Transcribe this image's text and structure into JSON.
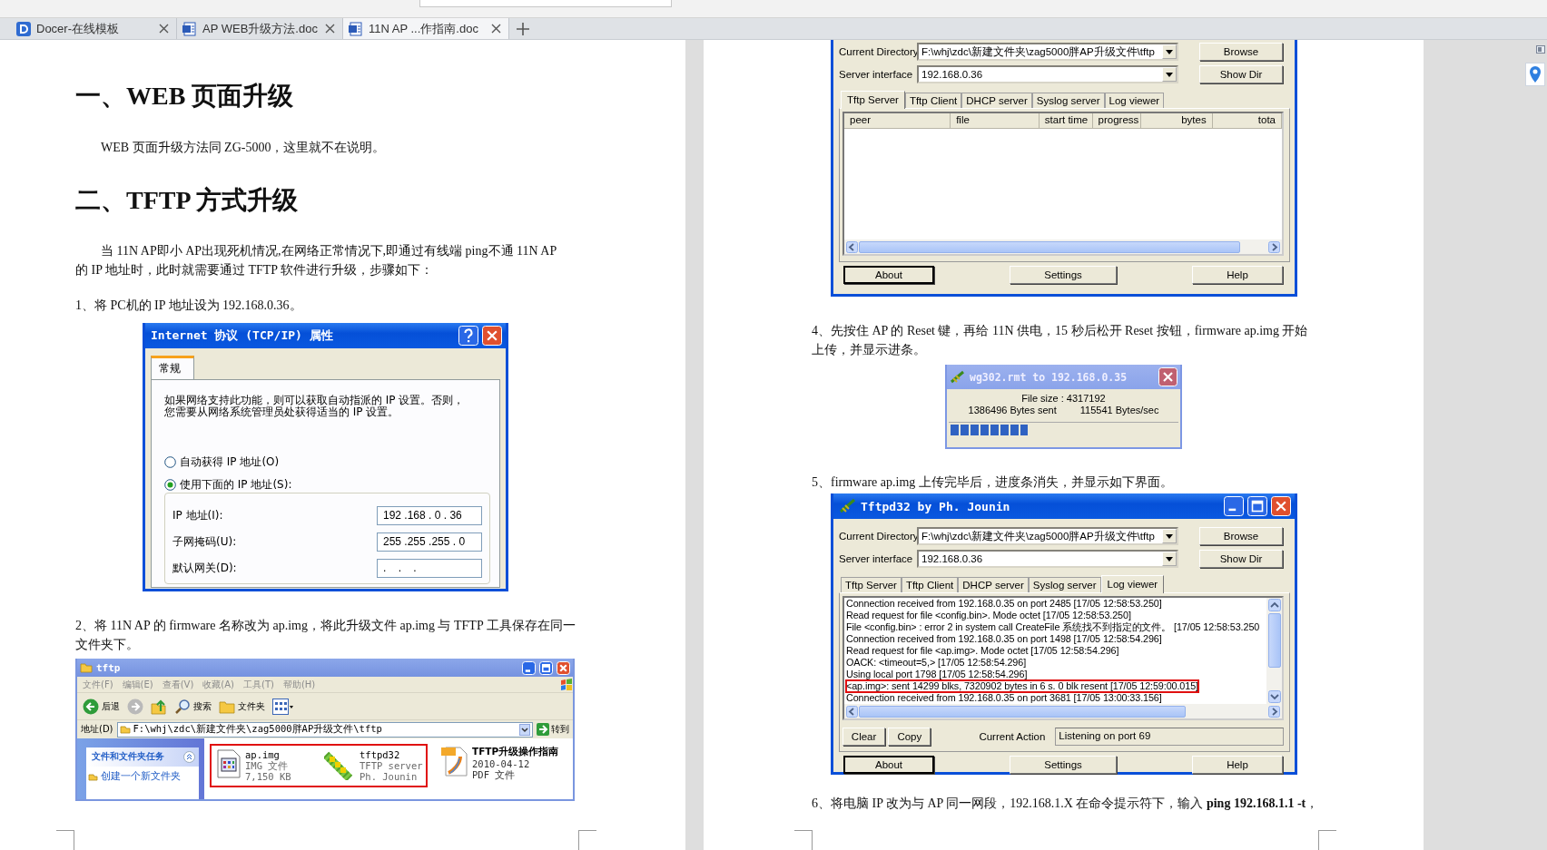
{
  "tabs": [
    {
      "label": "Docer-在线模板",
      "kind": "docer",
      "selected": false
    },
    {
      "label": "AP WEB升级方法.doc",
      "kind": "doc",
      "selected": false
    },
    {
      "label": "11N AP ...作指南.doc",
      "kind": "doc",
      "selected": true
    }
  ],
  "pages": [
    {
      "blocks": [
        {
          "kind": "heading",
          "text": "一、WEB 页面升级"
        },
        {
          "kind": "paragraph",
          "indent": true,
          "lines": [
            "WEB 页面升级方法同 ZG-5000，这里就不在说明。"
          ]
        },
        {
          "kind": "heading",
          "text": "二、TFTP 方式升级"
        },
        {
          "kind": "paragraph",
          "indent": true,
          "lines": [
            "当 11N AP即小 AP出现死机情况,在网络正常情况下,即通过有线端 ping不通 11N AP",
            "的 IP 地址时，此时就需要通过 TFTP 软件进行升级，步骤如下："
          ]
        },
        {
          "kind": "paragraph",
          "indent": false,
          "lines": [
            "1、将 PC机的 IP 地址设为 192.168.0.36。"
          ]
        },
        {
          "kind": "tcpip_dialog",
          "title": "Internet 协议 (TCP/IP) 属性",
          "tabs": [
            {
              "label": "常规",
              "selected": true
            }
          ],
          "description": [
            "如果网络支持此功能，则可以获取自动指派的 IP 设置。否则，",
            "您需要从网络系统管理员处获得适当的 IP 设置。"
          ],
          "options": [
            {
              "label": "自动获得 IP 地址(O)",
              "selected": false
            },
            {
              "label": "使用下面的 IP 地址(S):",
              "selected": true
            }
          ],
          "fields": [
            {
              "label": "IP 地址(I):",
              "value": "192 .168 . 0 . 36"
            },
            {
              "label": "子网掩码(U):",
              "value": "255 .255 .255 . 0"
            },
            {
              "label": "默认网关(D):",
              "value": ".    .    ."
            }
          ]
        },
        {
          "kind": "paragraph",
          "indent": false,
          "lines": [
            "2、将 11N AP 的 firmware  名称改为 ap.img，将此升级文件 ap.img 与 TFTP 工具保存在同一",
            "文件夹下。"
          ]
        },
        {
          "kind": "explorer_window",
          "title": "tftp",
          "menu": [
            "文件(F)",
            "编辑(E)",
            "查看(V)",
            "收藏(A)",
            "工具(T)",
            "帮助(H)"
          ],
          "toolbar": [
            {
              "kind": "back",
              "label": "后退"
            },
            {
              "kind": "forward"
            },
            {
              "kind": "up"
            },
            {
              "kind": "search",
              "label": "搜索"
            },
            {
              "kind": "folders",
              "label": "文件夹"
            },
            {
              "kind": "views"
            }
          ],
          "address_label": "地址(D)",
          "address": "F:\\whj\\zdc\\新建文件夹\\zag5000胖AP升级文件\\tftp",
          "go": "转到",
          "task_panel": {
            "title": "文件和文件夹任务",
            "items": [
              "创建一个新文件夹"
            ]
          },
          "files": [
            {
              "kind": "image",
              "name": "ap.img",
              "lines": [
                "IMG 文件",
                "7,150 KB"
              ],
              "highlighted": true
            },
            {
              "kind": "tftp",
              "name": "tftpd32",
              "lines": [
                "TFTP server",
                "Ph. Jounin"
              ],
              "highlighted": true
            },
            {
              "kind": "pdf",
              "name": "TFTP升级操作指南",
              "lines": [
                "2010-04-12",
                "PDF 文件"
              ],
              "highlighted": false
            }
          ]
        }
      ]
    },
    {
      "blocks": [
        {
          "kind": "tftpd_window",
          "directory_label": "Current Directory",
          "directory": "F:\\whj\\zdc\\新建文件夹\\zag5000胖AP升级文件\\tftp",
          "interface_label": "Server interface",
          "interface": "192.168.0.36",
          "side_buttons": [
            "Browse",
            "Show Dir"
          ],
          "tabs": [
            {
              "label": "Tftp Server",
              "selected": true
            },
            {
              "label": "Tftp Client",
              "selected": false
            },
            {
              "label": "DHCP server",
              "selected": false
            },
            {
              "label": "Syslog server",
              "selected": false
            },
            {
              "label": "Log viewer",
              "selected": false
            }
          ],
          "panel": {
            "kind": "table",
            "columns": [
              "peer",
              "file",
              "start time",
              "progress",
              "bytes",
              "tota"
            ]
          },
          "bottom_buttons": [
            "About",
            "Settings",
            "Help"
          ]
        },
        {
          "kind": "paragraph",
          "indent": false,
          "lines": [
            "4、先按住 AP  的 Reset 键，再给 11N 供电，15 秒后松开 Reset 按钮，firmware ap.img 开始",
            "上传，并显示进条。"
          ]
        },
        {
          "kind": "progress_dialog",
          "title": "wg302.rmt to 192.168.0.35",
          "file_size": "File size : 4317192",
          "sent": "1386496 Bytes sent",
          "rate": "115541 Bytes/sec",
          "level": 0.34
        },
        {
          "kind": "paragraph",
          "indent": false,
          "lines": [
            "5、firmware ap.img 上传完毕后，进度条消失，并显示如下界面。"
          ]
        },
        {
          "kind": "tftpd_window",
          "title": "Tftpd32 by Ph. Jounin",
          "directory_label": "Current Directory",
          "directory": "F:\\whj\\zdc\\新建文件夹\\zag5000胖AP升级文件\\tftp",
          "interface_label": "Server interface",
          "interface": "192.168.0.36",
          "side_buttons": [
            "Browse",
            "Show Dir"
          ],
          "tabs": [
            {
              "label": "Tftp Server",
              "selected": false
            },
            {
              "label": "Tftp Client",
              "selected": false
            },
            {
              "label": "DHCP server",
              "selected": false
            },
            {
              "label": "Syslog server",
              "selected": false
            },
            {
              "label": "Log viewer",
              "selected": true
            }
          ],
          "panel": {
            "kind": "log",
            "lines": [
              {
                "text": "Connection received from 192.168.0.35 on port 2485 [17/05 12:58:53.250]",
                "highlighted": false
              },
              {
                "text": "Read request for file <config.bin>. Mode octet [17/05 12:58:53.250]",
                "highlighted": false
              },
              {
                "text": "File <config.bin> : error 2 in system call CreateFile 系统找不到指定的文件。  [17/05 12:58:53.250",
                "highlighted": false
              },
              {
                "text": "Connection received from 192.168.0.35 on port 1498 [17/05 12:58:54.296]",
                "highlighted": false
              },
              {
                "text": "Read request for file <ap.img>. Mode octet [17/05 12:58:54.296]",
                "highlighted": false
              },
              {
                "text": "OACK: <timeout=5,> [17/05 12:58:54.296]",
                "highlighted": false
              },
              {
                "text": "Using local port 1798 [17/05 12:58:54.296]",
                "highlighted": false
              },
              {
                "text": "<ap.img>: sent 14299 blks, 7320902 bytes in 6 s. 0 blk resent [17/05 12:59:00.015]",
                "highlighted": true
              },
              {
                "text": "Connection received from 192.168.0.35 on port 3681 [17/05 13:00:33.156]",
                "highlighted": false
              }
            ],
            "actions": [
              "Clear",
              "Copy"
            ],
            "action_label": "Current Action",
            "action_value": "Listening on port 69"
          },
          "bottom_buttons": [
            "About",
            "Settings",
            "Help"
          ]
        },
        {
          "kind": "paragraph",
          "indent": false,
          "lines": [
            "6、将电脑 IP 改为与 AP 同一网段，192.168.1.X   在命令提示符下，输入 **ping 192.168.1.1 -t**，"
          ]
        }
      ]
    }
  ]
}
